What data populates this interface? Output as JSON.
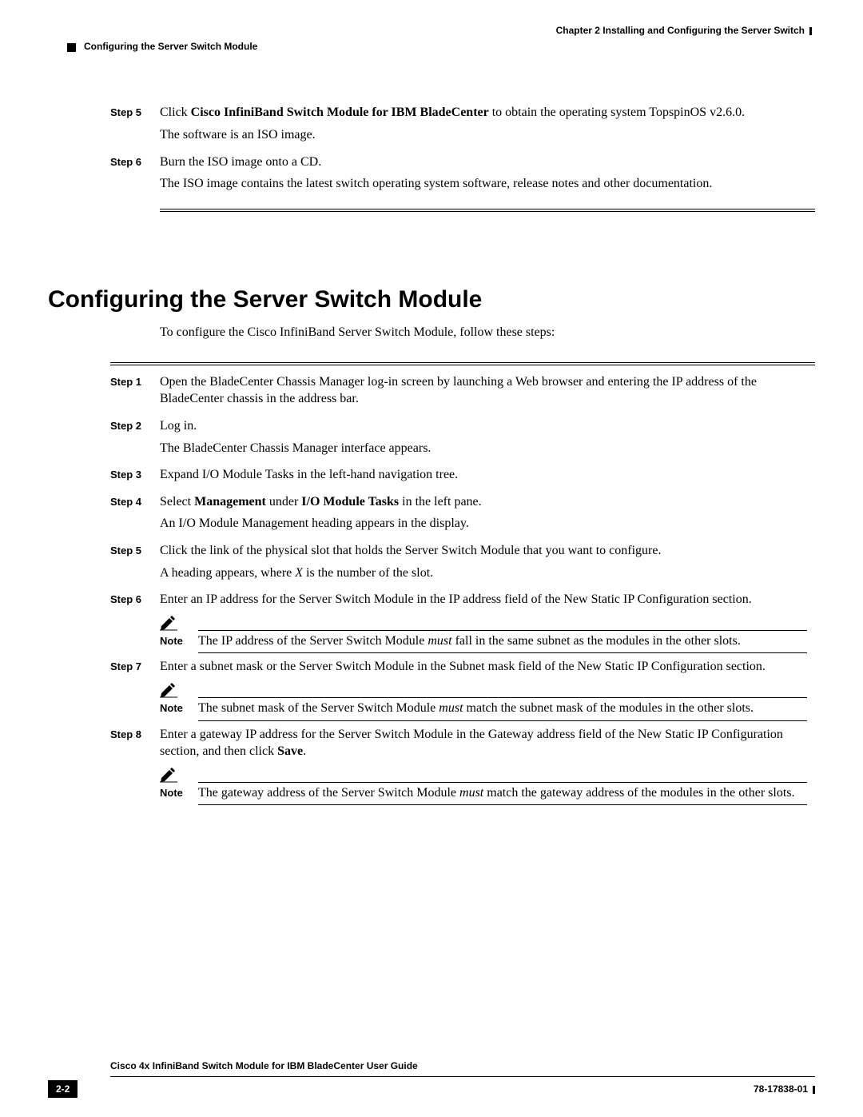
{
  "header": {
    "chapter": "Chapter 2      Installing and Configuring the Server Switch",
    "section": "Configuring the Server Switch Module"
  },
  "top_steps": [
    {
      "label": "Step 5",
      "body": [
        {
          "runs": [
            {
              "t": "Click "
            },
            {
              "t": "Cisco InfiniBand Switch Module for IBM BladeCenter",
              "b": true
            },
            {
              "t": " to obtain the operating system TopspinOS v2.6.0."
            }
          ]
        },
        {
          "runs": [
            {
              "t": "The software is an ISO image."
            }
          ]
        }
      ]
    },
    {
      "label": "Step 6",
      "body": [
        {
          "runs": [
            {
              "t": "Burn the ISO image onto a CD."
            }
          ]
        },
        {
          "runs": [
            {
              "t": "The ISO image contains the latest switch operating system software, release notes and other documentation."
            }
          ]
        }
      ]
    }
  ],
  "section_title": "Configuring the Server Switch Module",
  "intro": "To configure the Cisco InfiniBand Server Switch Module, follow these steps:",
  "steps": [
    {
      "label": "Step 1",
      "body": [
        {
          "runs": [
            {
              "t": "Open the BladeCenter Chassis Manager log-in screen by launching a Web browser and entering the IP address of the BladeCenter chassis in the address bar."
            }
          ]
        }
      ]
    },
    {
      "label": "Step 2",
      "body": [
        {
          "runs": [
            {
              "t": "Log in."
            }
          ]
        },
        {
          "runs": [
            {
              "t": "The BladeCenter Chassis Manager interface appears."
            }
          ]
        }
      ]
    },
    {
      "label": "Step 3",
      "body": [
        {
          "runs": [
            {
              "t": "Expand I/O Module Tasks in the left-hand navigation tree."
            }
          ]
        }
      ]
    },
    {
      "label": "Step 4",
      "body": [
        {
          "runs": [
            {
              "t": "Select "
            },
            {
              "t": "Management",
              "b": true
            },
            {
              "t": " under "
            },
            {
              "t": "I/O Module Tasks",
              "b": true
            },
            {
              "t": " in the left pane."
            }
          ]
        },
        {
          "runs": [
            {
              "t": "An I/O Module Management heading appears in the display."
            }
          ]
        }
      ]
    },
    {
      "label": "Step 5",
      "body": [
        {
          "runs": [
            {
              "t": "Click the link of the physical slot that holds the Server Switch Module that you want to configure."
            }
          ]
        },
        {
          "runs": [
            {
              "t": "A heading appears, where "
            },
            {
              "t": "X",
              "i": true
            },
            {
              "t": " is the number of the slot."
            }
          ]
        }
      ]
    },
    {
      "label": "Step 6",
      "body": [
        {
          "runs": [
            {
              "t": "Enter an IP address for the Server Switch Module in the IP address field of the New Static IP Configuration section."
            }
          ]
        }
      ],
      "note": {
        "runs": [
          {
            "t": "The IP address of the Server Switch Module "
          },
          {
            "t": "must",
            "i": true
          },
          {
            "t": " fall in the same subnet as the modules in the other slots."
          }
        ]
      }
    },
    {
      "label": "Step 7",
      "body": [
        {
          "runs": [
            {
              "t": "Enter a subnet mask or the Server Switch Module in the Subnet mask field of the New Static IP Configuration section."
            }
          ]
        }
      ],
      "note": {
        "runs": [
          {
            "t": "The subnet mask of the Server Switch Module "
          },
          {
            "t": "must",
            "i": true
          },
          {
            "t": " match the subnet mask of the modules in the other slots."
          }
        ]
      }
    },
    {
      "label": "Step 8",
      "body": [
        {
          "runs": [
            {
              "t": "Enter a gateway IP address for the Server Switch Module in the Gateway address field of the New Static IP Configuration section, and then click "
            },
            {
              "t": "Save",
              "b": true
            },
            {
              "t": "."
            }
          ]
        }
      ],
      "note": {
        "runs": [
          {
            "t": "The gateway address of the Server Switch Module "
          },
          {
            "t": "must",
            "i": true
          },
          {
            "t": " match the gateway address of the modules in the other slots."
          }
        ]
      }
    }
  ],
  "note_label": "Note",
  "footer": {
    "title": "Cisco 4x InfiniBand Switch Module for IBM BladeCenter User Guide",
    "page": "2-2",
    "docnum": "78-17838-01"
  }
}
